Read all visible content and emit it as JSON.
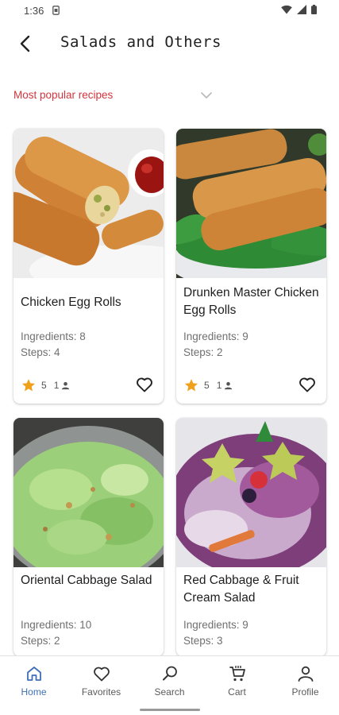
{
  "status_bar": {
    "time": "1:36"
  },
  "app_bar": {
    "title": "Salads and Others"
  },
  "filter": {
    "label": "Most popular recipes"
  },
  "recipes": [
    {
      "title": "Chicken Egg Rolls",
      "ingredients": "Ingredients: 8",
      "steps": "Steps: 4",
      "rating": "5",
      "reviews": "1"
    },
    {
      "title": "Drunken Master Chicken Egg Rolls",
      "ingredients": "Ingredients: 9",
      "steps": "Steps: 2",
      "rating": "5",
      "reviews": "1"
    },
    {
      "title": "Oriental Cabbage Salad",
      "ingredients": "Ingredients: 10",
      "steps": "Steps: 2"
    },
    {
      "title": "Red Cabbage & Fruit Cream Salad",
      "ingredients": "Ingredients: 9",
      "steps": "Steps: 3"
    }
  ],
  "bottom_nav": [
    {
      "label": "Home",
      "icon": "home-icon",
      "active": true
    },
    {
      "label": "Favorites",
      "icon": "heart-icon"
    },
    {
      "label": "Search",
      "icon": "search-icon"
    },
    {
      "label": "Cart",
      "icon": "cart-icon"
    },
    {
      "label": "Profile",
      "icon": "person-icon"
    }
  ],
  "colors": {
    "accent": "#d6343e",
    "active_nav": "#3f6fb6",
    "star": "#f0a11b"
  }
}
